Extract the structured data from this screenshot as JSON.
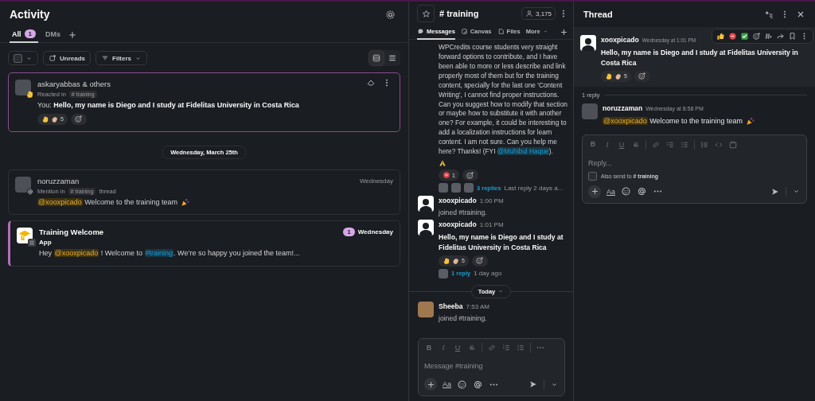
{
  "activity": {
    "title": "Activity",
    "tabs": [
      {
        "label": "All",
        "badge": "1",
        "selected": true
      },
      {
        "label": "DMs",
        "selected": false
      }
    ],
    "select_all": {
      "checked": false
    },
    "filters": [
      {
        "kind": "unreads",
        "label": "Unreads"
      },
      {
        "kind": "filters",
        "label": "Filters"
      }
    ],
    "view_modes": [
      {
        "kind": "cards",
        "selected": true
      },
      {
        "kind": "list",
        "selected": false
      }
    ],
    "items": [
      {
        "kind": "reaction",
        "selected": true,
        "title": "askaryabbas & others",
        "context": "Reacted in",
        "channel": "# training",
        "prefix": "You:",
        "text": "Hello, my name is Diego and I study at Fidelitas University in Costa Rica",
        "reaction_count": "5"
      },
      {
        "kind": "divider",
        "label": "Wednesday, March 25th"
      },
      {
        "kind": "mention",
        "selected": false,
        "title": "noruzzaman",
        "context": "Mention in",
        "channel": "# training",
        "suffix": "thread",
        "time": "Wednesday",
        "segments": [
          {
            "kind": "mention",
            "text": "@xooxpicado"
          },
          {
            "kind": "text",
            "text": " Welcome to the training team"
          }
        ]
      },
      {
        "kind": "app",
        "selected": false,
        "unread": true,
        "title": "Training Welcome",
        "subtitle": "App",
        "badge": "1",
        "time": "Wednesday",
        "segments": [
          {
            "kind": "text",
            "text": "Hey "
          },
          {
            "kind": "mention",
            "text": "@xooxpicado"
          },
          {
            "kind": "text",
            "text": " ! Welcome to "
          },
          {
            "kind": "channel",
            "text": "#training"
          },
          {
            "kind": "text",
            "text": ". We’re so happy you joined the team!..."
          }
        ]
      }
    ]
  },
  "channel": {
    "name": "# training",
    "members": "3,175",
    "tabs": [
      {
        "kind": "messages",
        "label": "Messages",
        "selected": true
      },
      {
        "kind": "canvas",
        "label": "Canvas",
        "selected": false
      },
      {
        "kind": "files",
        "label": "Files",
        "selected": false
      },
      {
        "kind": "more",
        "label": "More",
        "selected": false
      }
    ],
    "messages": [
      {
        "kind": "continued",
        "segments": [
          {
            "kind": "text",
            "text": "WPCredits course students very straight forward options to contribute, and I have been able to more or less describe and link properly most of them but for the training content, specially for the last one 'Content Writing', I cannot find proper instructions. Can you suggest how to modify that section or maybe how to substitute it with another one? For example, it could be interesting to add a localization instructions for learn content. I am not sure. Can you help me here? Thanks! (FYI "
          },
          {
            "kind": "mention_blue",
            "text": "@Muhibul Haque"
          },
          {
            "kind": "text",
            "text": "). "
          }
        ],
        "reaction_count": "1",
        "replies": "3 replies",
        "last_reply": "Last reply 2 days a..."
      },
      {
        "kind": "system",
        "author": "xooxpicado",
        "time": "1:00 PM",
        "text": "joined #training."
      },
      {
        "kind": "message",
        "author": "xooxpicado",
        "time": "1:01 PM",
        "text": "Hello, my name is Diego and I study at Fidelitas University in Costa Rica",
        "reaction_count": "5",
        "replies": "1 reply",
        "last_reply": "1 day ago"
      },
      {
        "kind": "divider",
        "label": "Today"
      },
      {
        "kind": "system_photo",
        "author": "Sheeba",
        "time": "7:53 AM",
        "text": "joined #training."
      }
    ],
    "composer": {
      "placeholder": "Message #training",
      "text_format": "Aa",
      "format": [
        {
          "kind": "bold",
          "glyph": "B"
        },
        {
          "kind": "italic",
          "glyph": "I"
        },
        {
          "kind": "underline",
          "glyph": "U"
        },
        {
          "kind": "strike",
          "glyph": "S"
        }
      ],
      "extra": false
    }
  },
  "thread": {
    "title": "Thread",
    "parent": {
      "author": "xooxpicado",
      "time": "Wednesday at 1:01 PM",
      "text": "Hello, my name is Diego and I study at Fidelitas University in Costa Rica",
      "reaction_count": "5"
    },
    "reply_count": "1 reply",
    "replies": [
      {
        "author": "noruzzaman",
        "time": "Wednesday at 8:58 PM",
        "segments": [
          {
            "kind": "mention",
            "text": "@xooxpicado"
          },
          {
            "kind": "text",
            "text": " Welcome to the training team"
          }
        ]
      }
    ],
    "composer": {
      "placeholder": "Reply...",
      "text_format": "Aa",
      "format": [
        {
          "kind": "bold",
          "glyph": "B"
        },
        {
          "kind": "italic",
          "glyph": "I"
        },
        {
          "kind": "underline",
          "glyph": "U"
        },
        {
          "kind": "strike",
          "glyph": "S"
        }
      ],
      "extra": true,
      "also_send": {
        "checked": false,
        "label": "Also send to",
        "channel": "# training"
      }
    }
  }
}
